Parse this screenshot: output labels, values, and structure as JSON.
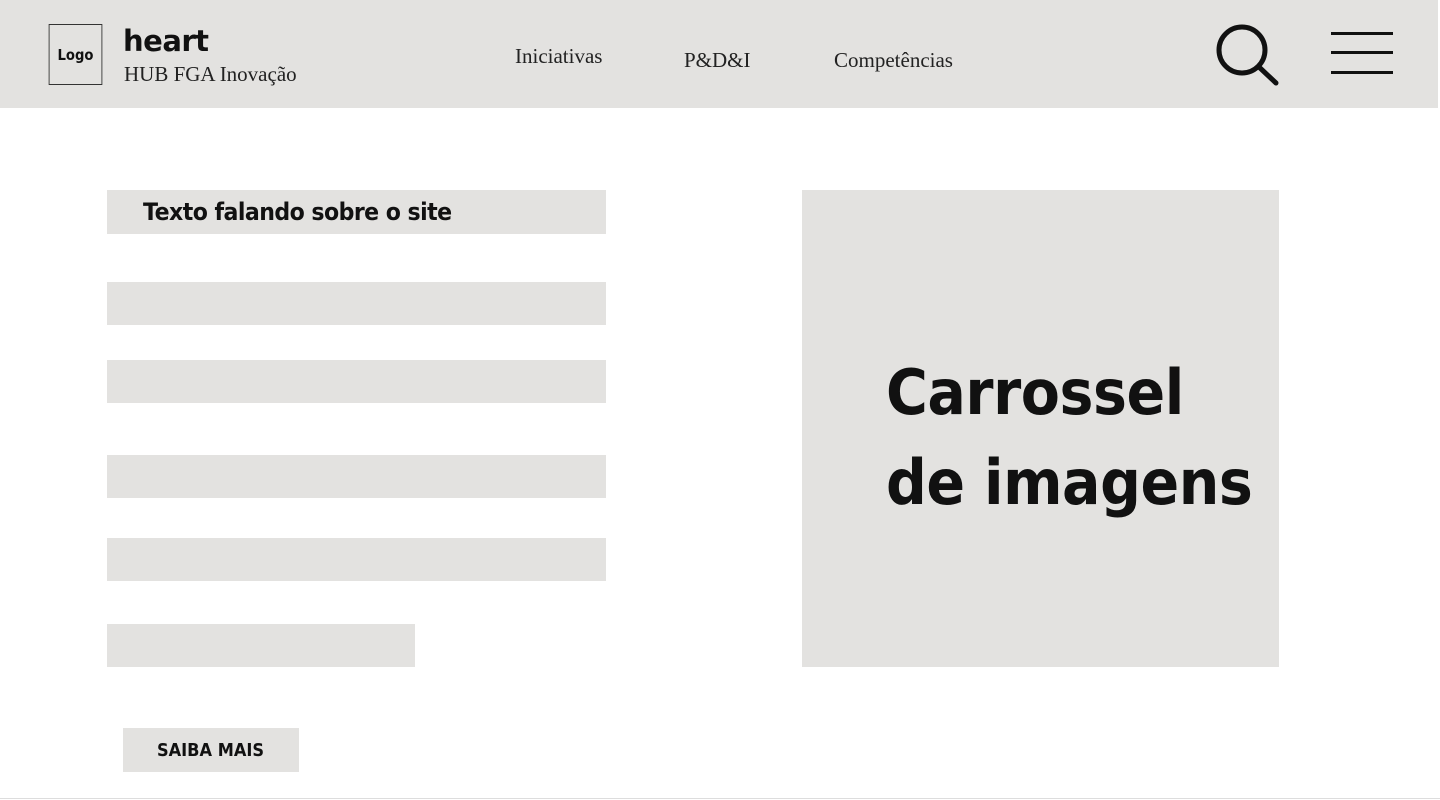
{
  "header": {
    "logo_label": "Logo",
    "brand_title": "heart",
    "brand_subtitle": "HUB FGA Inovação",
    "nav": [
      "Iniciativas",
      "P&D&I",
      "Competências"
    ],
    "search_icon": "search-icon",
    "menu_icon": "hamburger-menu-icon"
  },
  "main": {
    "text_heading": "Texto falando sobre o site",
    "cta_label": "SAIBA MAIS"
  },
  "carousel": {
    "line1": "Carrossel",
    "line2": "de imagens"
  },
  "colors": {
    "placeholder_gray": "#e3e2e0",
    "background": "#ffffff",
    "text": "#111111"
  }
}
